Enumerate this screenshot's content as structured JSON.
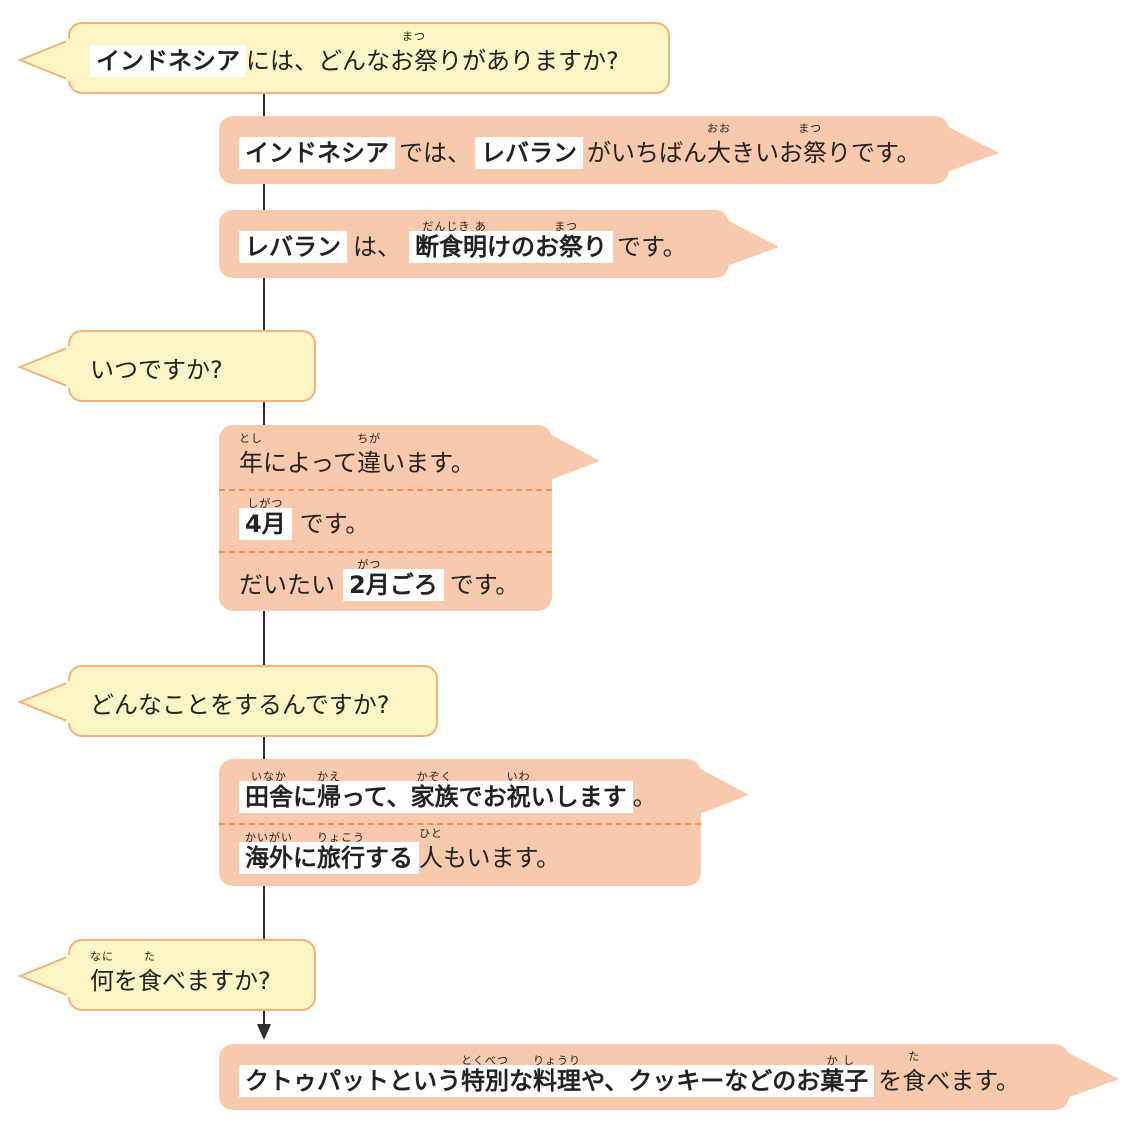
{
  "q1": {
    "hl": "インドネシア",
    "pre": "には、どんな",
    "kanji": "お祭",
    "ruby": "まつ",
    "post": "りがありますか?"
  },
  "a1": {
    "l1": {
      "hl1": "インドネシア",
      "t1": "では、",
      "hl2": "レバラン",
      "t2": "がいちばん",
      "k1": "大",
      "r1": "おお",
      "t3": "きい",
      "k2": "お祭",
      "r2": "まつ",
      "t4": "りです。"
    },
    "l2": {
      "hl1": "レバラン",
      "t1": "は、",
      "k1": "断食明",
      "r1": "だんじき あ",
      "h2a": "けの",
      "k2": "お祭",
      "r2": "まつ",
      "h2b": "り",
      "t2": "です。"
    }
  },
  "q2": {
    "text": "いつですか?"
  },
  "a2": {
    "l1": {
      "k1": "年",
      "r1": "とし",
      "t1": "によって",
      "k2": "違",
      "r2": "ちが",
      "t2": "います。"
    },
    "l2": {
      "k1": "4月",
      "r1": "しがつ",
      "t1": "です。"
    },
    "l3": {
      "t0": "だいたい",
      "k1": "2月",
      "r1": "がつ",
      "h1b": "ごろ",
      "t1": "です。"
    }
  },
  "q3": {
    "text": "どんなことをするんですか?"
  },
  "a3": {
    "l1": {
      "k1": "田舎",
      "r1": "いなか",
      "h1": "に",
      "k2": "帰",
      "r2": "かえ",
      "h2": "って、",
      "k3": "家族",
      "r3": "かぞく",
      "h3": "でお",
      "k4": "祝",
      "r4": "いわ",
      "h4": "いします",
      "t1": "。"
    },
    "l2": {
      "k1": "海外",
      "r1": "かいがい",
      "h1": "に",
      "k2": "旅行",
      "r2": "りょこう",
      "h2": "する",
      "k3": "人",
      "r3": "ひと",
      "t1": "もいます。"
    }
  },
  "q4": {
    "k1": "何",
    "r1": "なに",
    "t1": "を",
    "k2": "食",
    "r2": "た",
    "t2": "べますか?"
  },
  "a4": {
    "h0": "クトゥパットという",
    "k1": "特別",
    "r1": "とくべつ",
    "h1": "な",
    "k2": "料理",
    "r2": "りょうり",
    "h2": "や、クッキーなどの",
    "k3": "お菓子",
    "r3": "か し",
    "k4": "食",
    "r4": "た",
    "t1": "を",
    "t2": "べます。"
  },
  "colors": {
    "question_bg": "#fdf5c6",
    "question_border": "#f2b27a",
    "answer_bg": "#f8c9ad",
    "divider": "#ef9254"
  }
}
